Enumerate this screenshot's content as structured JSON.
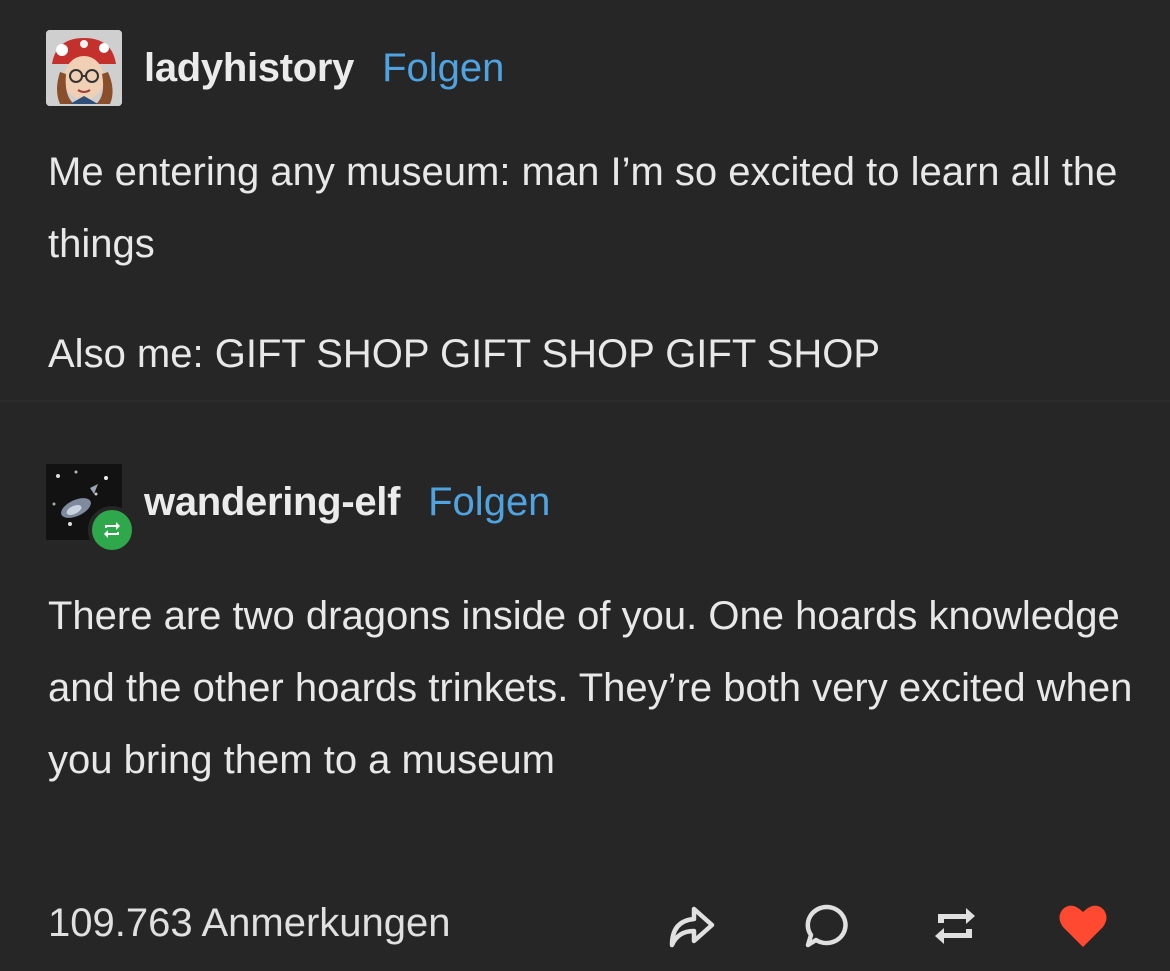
{
  "posts": [
    {
      "username": "ladyhistory",
      "follow_label": "Folgen",
      "paragraphs": [
        "Me entering any museum: man I’m so excited to learn all the things",
        "Also me: GIFT SHOP GIFT SHOP GIFT SHOP"
      ]
    },
    {
      "username": "wandering-elf",
      "follow_label": "Folgen",
      "paragraphs": [
        "There are two dragons inside of you. One hoards knowledge and the other hoards trinkets. They’re both very excited when you bring them to a museum"
      ]
    }
  ],
  "footer": {
    "notes": "109.763 Anmerkungen",
    "icons": [
      "share-icon",
      "reply-icon",
      "reblog-icon",
      "heart-icon"
    ]
  },
  "colors": {
    "background": "#262626",
    "follow": "#4fa3e0",
    "like": "#ff4930",
    "reblog_badge": "#2ea84a"
  }
}
